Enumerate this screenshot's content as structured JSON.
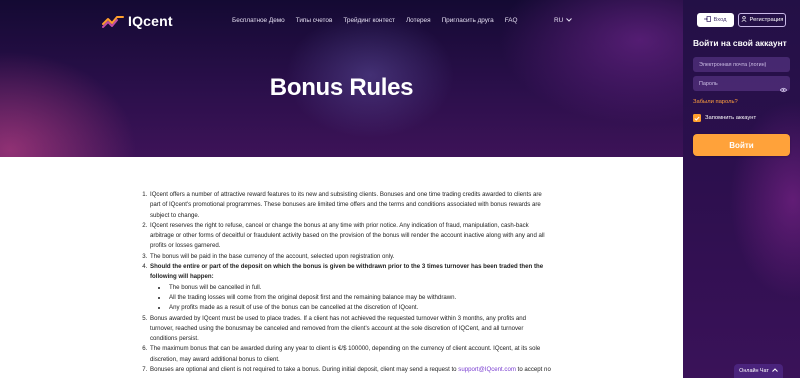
{
  "nav": {
    "logo_text": "IQcent",
    "links": [
      {
        "label": "Бесплатное Демо"
      },
      {
        "label": "Типы счетов"
      },
      {
        "label": "Трейдинг контест"
      },
      {
        "label": "Лотерея"
      },
      {
        "label": "Пригласить друга"
      },
      {
        "label": "FAQ"
      }
    ],
    "language": "RU"
  },
  "hero": {
    "title": "Bonus Rules"
  },
  "panel": {
    "login_label": "Вход",
    "register_label": "Регистрация",
    "title": "Войти на свой аккаунт",
    "email_placeholder": "Электронная почта (логин)",
    "password_placeholder": "Пароль",
    "forgot_label": "Забыли пароль?",
    "remember_label": "Запомнить аккаунт",
    "remember_checked": true,
    "submit_label": "Войти"
  },
  "rules": {
    "items": [
      "IQcent offers a number of attractive reward features to its new and subsisting clients. Bonuses and one time trading credits awarded to clients are part of IQcent's promotional programmes. These bonuses are limited time offers and the terms and conditions associated with bonus rewards are subject to change.",
      "IQcent reserves the right to refuse, cancel or change the bonus at any time with prior notice. Any indication of fraud, manipulation, cash-back arbitrage or other forms of deceitful or fraudulent activity based on the provision of the bonus will render the account inactive along with any and all profits or losses garnered.",
      "The bonus will be paid in the base currency of the account, selected upon registration only.",
      "Should the entire or part of the deposit on which the bonus is given be withdrawn prior to the 3 times turnover has been traded then the following will happen:",
      "Bonus awarded by IQcent must be used to place trades. If a client has not achieved the requested turnover within 3 months, any profits and turnover, reached using the bonusmay be canceled and removed from the client's account at the sole discretion of IQCent, and all turnover conditions persist.",
      "The maximum bonus that can be awarded during any year to client is €/$ 100000, depending on the currency of client account. IQcent, at its sole discretion, may award additional bonus to client."
    ],
    "sub_items": [
      "The bonus will be cancelled in full.",
      "All the trading losses will come from the original deposit first and the remaining balance may be withdrawn.",
      "Any profits made as a result of use of the bonus can be cancelled at the discretion of IQcent."
    ],
    "last_item_prefix": "Bonuses are optional and client is not required to take a bonus. During initial deposit, client may send a request to ",
    "last_item_email": "support@IQcent.com",
    "last_item_suffix": " to accept no"
  },
  "chat": {
    "label": "Онлайн Чат"
  },
  "colors": {
    "accent": "#ffa23a",
    "panel_bg": "#2d0f4e",
    "hero_bg": "#1e0c3d",
    "chat_bg": "#4a237c",
    "link": "#7a3ed1"
  }
}
